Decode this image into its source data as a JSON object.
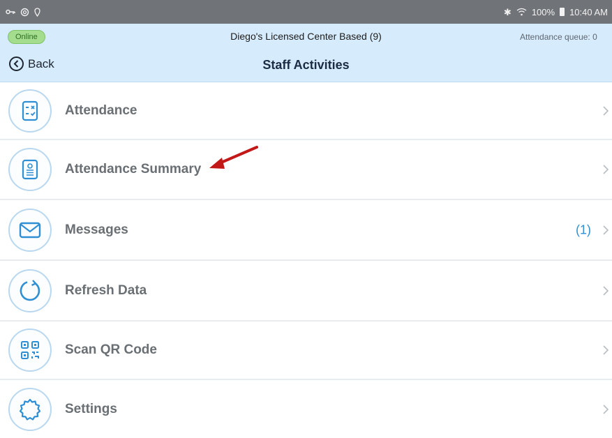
{
  "status_bar": {
    "left_icons": [
      "key-icon",
      "sync-icon",
      "location-pin-icon"
    ],
    "right_icons": [
      "bluetooth-icon",
      "wifi-icon",
      "battery-icon"
    ],
    "battery": "100%",
    "time": "10:40 AM"
  },
  "header": {
    "status_badge": "Online",
    "center_title": "Diego's Licensed Center Based (9)",
    "queue_label": "Attendance queue: 0",
    "back_label": "Back",
    "page_title": "Staff Activities"
  },
  "menu": {
    "items": [
      {
        "label": "Attendance",
        "icon": "attendance-checklist-icon"
      },
      {
        "label": "Attendance Summary",
        "icon": "attendance-summary-icon"
      },
      {
        "label": "Messages",
        "icon": "envelope-icon",
        "count": "(1)"
      },
      {
        "label": "Refresh Data",
        "icon": "refresh-icon"
      },
      {
        "label": "Scan QR Code",
        "icon": "qr-code-icon"
      },
      {
        "label": "Settings",
        "icon": "gear-icon"
      }
    ]
  },
  "colors": {
    "header_bg": "#d6ebfb",
    "accent": "#2f8fd4",
    "online_badge": "#a5dd8f",
    "annotation_arrow": "#c21818"
  }
}
